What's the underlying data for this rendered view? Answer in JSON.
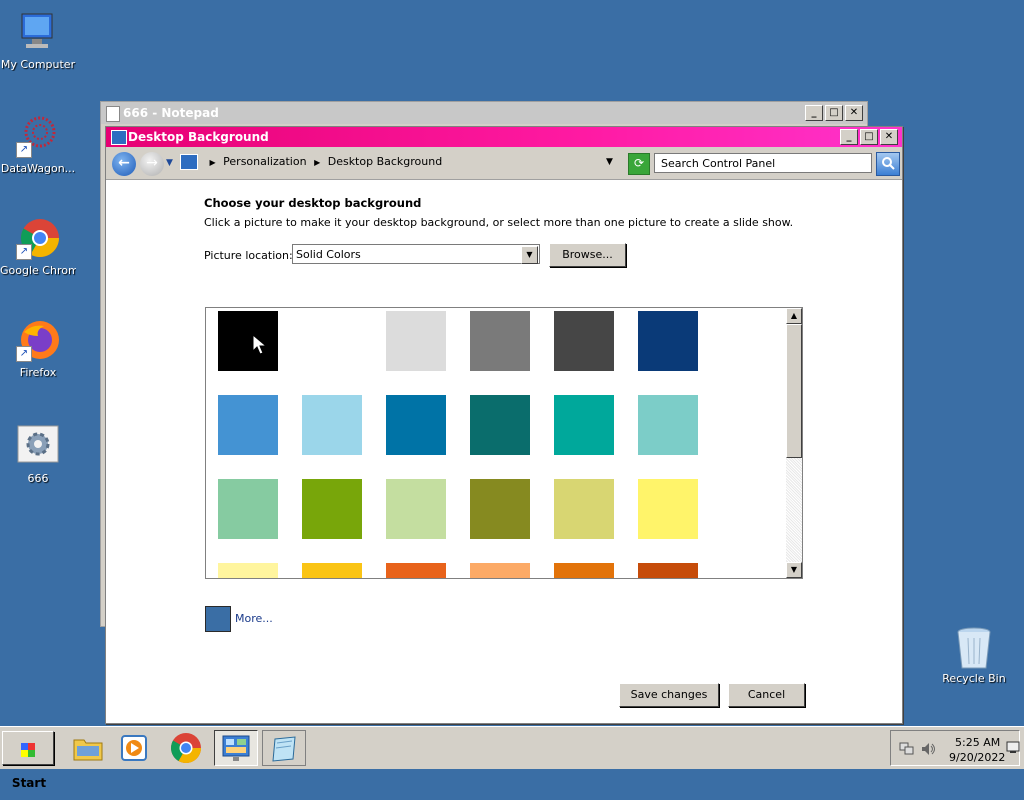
{
  "desktop": {
    "icons": [
      {
        "label": "My Computer"
      },
      {
        "label": "DataWagon..."
      },
      {
        "label": "Google Chrome"
      },
      {
        "label": "Firefox"
      },
      {
        "label": "666"
      },
      {
        "label": "Recycle Bin"
      }
    ]
  },
  "notepad": {
    "title": "666 - Notepad"
  },
  "window": {
    "title": "Desktop Background",
    "breadcrumb": [
      "Personalization",
      "Desktop Background"
    ],
    "search_placeholder": "Search Control Panel",
    "heading": "Choose your desktop background",
    "description": "Click a picture to make it your desktop background, or select more than one picture to create a slide show.",
    "picture_location_label": "Picture location:",
    "picture_location_value": "Solid Colors",
    "browse_label": "Browse...",
    "more_label": "More...",
    "more_color": "#3a6ea5",
    "save_label": "Save changes",
    "cancel_label": "Cancel"
  },
  "swatches": [
    [
      "#000000",
      "#ffffff",
      "#dcdcdc",
      "#7a7a7a",
      "#464646",
      "#0a3a78"
    ],
    [
      "#4493d3",
      "#9bd6ea",
      "#0073a6",
      "#0a6d6c",
      "#00a89b",
      "#7ccdc8"
    ],
    [
      "#86cba1",
      "#78a60a",
      "#c4dea0",
      "#868a20",
      "#d8d672",
      "#fff46a"
    ],
    [
      "#fff59e",
      "#fac415",
      "#e8631b",
      "#fcaa66",
      "#e2730a",
      "#c64c0a"
    ]
  ],
  "taskbar": {
    "start_label": "Start",
    "time": "5:25 AM",
    "date": "9/20/2022"
  }
}
